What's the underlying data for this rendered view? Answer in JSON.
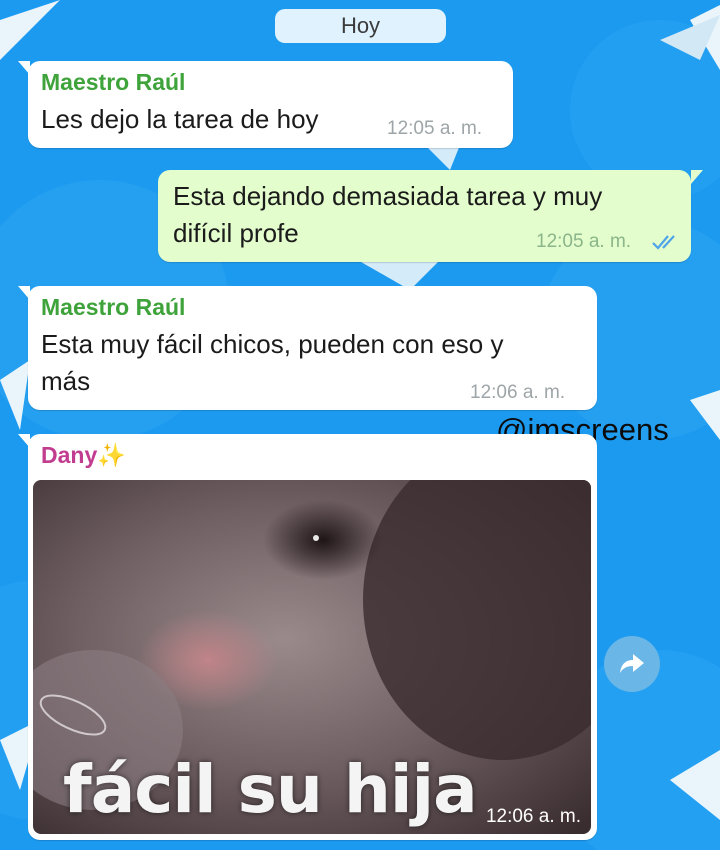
{
  "chat": {
    "date_label": "Hoy",
    "messages": [
      {
        "direction": "incoming",
        "sender": "Maestro Raúl",
        "lines": [
          "Les dejo la tarea de hoy"
        ],
        "time": "12:05 a. m."
      },
      {
        "direction": "outgoing",
        "lines": [
          "Esta dejando demasiada tarea y muy",
          "difícil profe"
        ],
        "time": "12:05 a. m.",
        "status": "read"
      },
      {
        "direction": "incoming",
        "sender": "Maestro Raúl",
        "lines": [
          "Esta muy fácil chicos, pueden con eso y",
          "más"
        ],
        "time": "12:06 a. m."
      },
      {
        "direction": "incoming",
        "sender": "Dany",
        "sender_emoji": "✨",
        "image": {
          "description_icon": "hamster-meme-image",
          "caption_text": "fácil su hija"
        },
        "time": "12:06 a. m."
      }
    ]
  },
  "watermark": "@imscreens",
  "icons": {
    "read_receipt": "double-check-icon",
    "forward": "forward-arrow-icon",
    "wallpaper": "paper-plane-icon"
  },
  "colors": {
    "background": "#1b9af0",
    "incoming_bubble": "#ffffff",
    "outgoing_bubble": "#e3fdcd",
    "sender_green": "#3fa33b",
    "sender_pink": "#c23c8f",
    "read_check": "#4fa3e8"
  }
}
